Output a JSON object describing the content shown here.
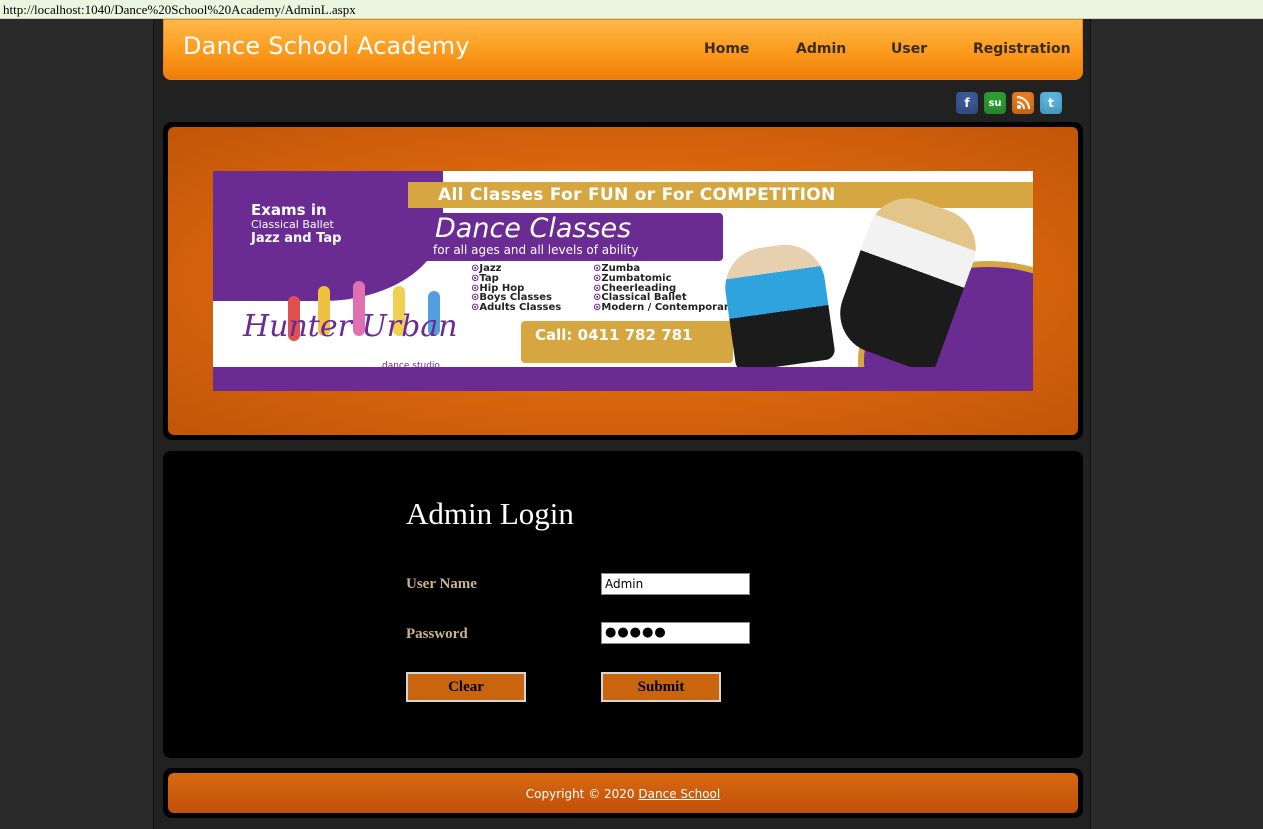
{
  "browser": {
    "url": "http://localhost:1040/Dance%20School%20Academy/AdminL.aspx"
  },
  "header": {
    "brand": "Dance School Academy",
    "nav": [
      "Home",
      "Admin",
      "User",
      "Registration"
    ]
  },
  "social_icons": [
    "facebook-icon",
    "stumbleupon-icon",
    "rss-icon",
    "twitter-icon"
  ],
  "banner": {
    "headline": "All Classes For FUN or For COMPETITION",
    "exams": {
      "line1": "Exams in",
      "line2": "Classical Ballet",
      "line3": "Jazz and Tap"
    },
    "classes_title": "Dance Classes",
    "classes_sub": "for all ages and all levels of ability",
    "list_left": [
      "Jazz",
      "Tap",
      "Hip Hop",
      "Boys Classes",
      "Adults Classes"
    ],
    "list_right": [
      "Zumba",
      "Zumbatomic",
      "Cheerleading",
      "Classical Ballet",
      "Modern / Contemporary"
    ],
    "call": "Call: 0411 782 781",
    "logo": "Hunter Urban",
    "logo_sub": "dance studio",
    "colors": {
      "purple": "#6a2b93",
      "gold": "#d6a640"
    }
  },
  "login": {
    "title": "Admin Login",
    "username_label": "User Name",
    "username_value": "Admin",
    "password_label": "Password",
    "password_value": "●●●●●",
    "clear_label": "Clear",
    "submit_label": "Submit"
  },
  "footer": {
    "copyright": "Copyright © 2020",
    "link": "Dance School"
  },
  "colors": {
    "accent_orange": "#fb9a1c",
    "button_orange": "#c9650e",
    "label_tan": "#c9b48e"
  }
}
